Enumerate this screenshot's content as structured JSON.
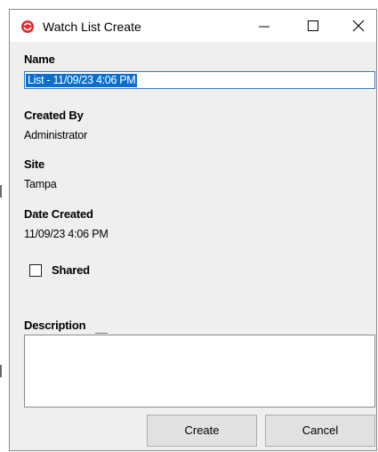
{
  "window": {
    "title": "Watch List Create",
    "minimize_icon": "minimize-icon",
    "maximize_icon": "maximize-icon",
    "close_icon": "close-icon",
    "app_icon": "watch-list-app-icon",
    "accent_color": "#e5292b",
    "selection_color": "#0a6ed0"
  },
  "form": {
    "name_label": "Name",
    "name_value": "List - 11/09/23 4:06 PM",
    "created_by_label": "Created By",
    "created_by_value": "Administrator",
    "site_label": "Site",
    "site_value": "Tampa",
    "date_created_label": "Date Created",
    "date_created_value": "11/09/23 4:06 PM",
    "shared_label": "Shared",
    "shared_checked": false,
    "description_label": "Description",
    "description_value": ""
  },
  "buttons": {
    "create": "Create",
    "cancel": "Cancel"
  }
}
